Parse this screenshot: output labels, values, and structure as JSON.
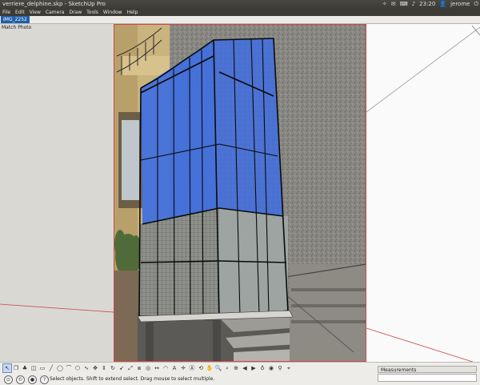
{
  "window": {
    "title": "verriere_delphine.skp - SketchUp Pro"
  },
  "tray": {
    "time": "23:20",
    "user": "jerome"
  },
  "menu": [
    "File",
    "Edit",
    "View",
    "Camera",
    "Draw",
    "Tools",
    "Window",
    "Help"
  ],
  "scene_tab": "IMG_2252",
  "viewport": {
    "label": "Match Photo"
  },
  "toolbar": {
    "tools": [
      "select-tool",
      "component-tool",
      "paint-bucket-tool",
      "eraser-tool",
      "rectangle-tool",
      "line-tool",
      "circle-tool",
      "arc-tool",
      "polygon-tool",
      "freehand-tool",
      "move-tool",
      "push-pull-tool",
      "rotate-tool",
      "follow-me-tool",
      "scale-tool",
      "offset-tool",
      "tape-measure-tool",
      "dimension-tool",
      "protractor-tool",
      "text-tool",
      "axes-tool",
      "3d-text-tool",
      "orbit-tool",
      "pan-tool",
      "zoom-tool",
      "zoom-window-tool",
      "zoom-extents-tool",
      "previous-view-tool",
      "next-view-tool",
      "position-camera-tool",
      "look-around-tool",
      "walk-tool",
      "section-plane-tool"
    ]
  },
  "status": {
    "text": "Select objects. Shift to extend select. Drag mouse to select multiple."
  },
  "measurements": {
    "label": "Measurements",
    "value": ""
  },
  "colors": {
    "accent": "#1f5ea8",
    "glass": "#3f6fe0"
  }
}
